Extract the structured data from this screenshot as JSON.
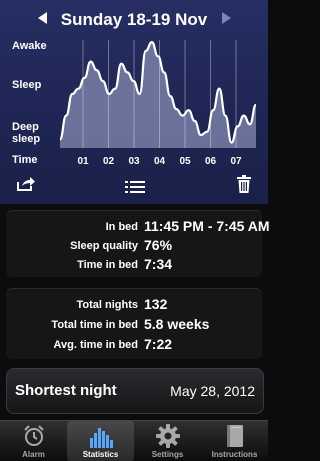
{
  "header": {
    "date_title": "Sunday 18-19 Nov",
    "prev_icon": "chevron-left-icon",
    "next_icon": "chevron-right-icon"
  },
  "graph": {
    "y_labels": {
      "awake": "Awake",
      "sleep": "Sleep",
      "deep_sleep_1": "Deep",
      "deep_sleep_2": "sleep"
    },
    "x_title": "Time",
    "hours": [
      "01",
      "02",
      "03",
      "04",
      "05",
      "06",
      "07"
    ],
    "sleep_depth_samples": [
      0.08,
      0.3,
      0.5,
      0.55,
      0.65,
      0.8,
      0.72,
      0.62,
      0.5,
      0.55,
      0.78,
      0.7,
      0.62,
      0.5,
      0.9,
      0.98,
      0.85,
      0.7,
      0.48,
      0.36,
      0.3,
      0.35,
      0.25,
      0.12,
      0.15,
      0.35,
      0.55,
      0.3,
      0.05,
      0.2,
      0.3,
      0.22,
      0.4
    ],
    "colors": {
      "fill": "#a9b0d6",
      "line": "#ffffff",
      "background": "#262e63"
    }
  },
  "toolbar": {
    "share_icon": "share-icon",
    "list_icon": "list-icon",
    "delete_icon": "trash-icon"
  },
  "night_stats": {
    "in_bed_label": "In bed",
    "in_bed_value": "11:45 PM - 7:45 AM",
    "quality_label": "Sleep quality",
    "quality_value": "76%",
    "time_label": "Time in bed",
    "time_value": "7:34"
  },
  "totals": {
    "nights_label": "Total nights",
    "nights_value": "132",
    "total_time_label": "Total time in bed",
    "total_time_value": "5.8 weeks",
    "avg_label": "Avg. time in bed",
    "avg_value": "7:22"
  },
  "shortest": {
    "label": "Shortest night",
    "date": "May 28, 2012"
  },
  "tabs": [
    {
      "label": "Alarm",
      "icon": "alarm-clock-icon",
      "active": false
    },
    {
      "label": "Statistics",
      "icon": "bar-chart-icon",
      "active": true
    },
    {
      "label": "Settings",
      "icon": "gear-icon",
      "active": false
    },
    {
      "label": "Instructions",
      "icon": "book-icon",
      "active": false
    }
  ]
}
